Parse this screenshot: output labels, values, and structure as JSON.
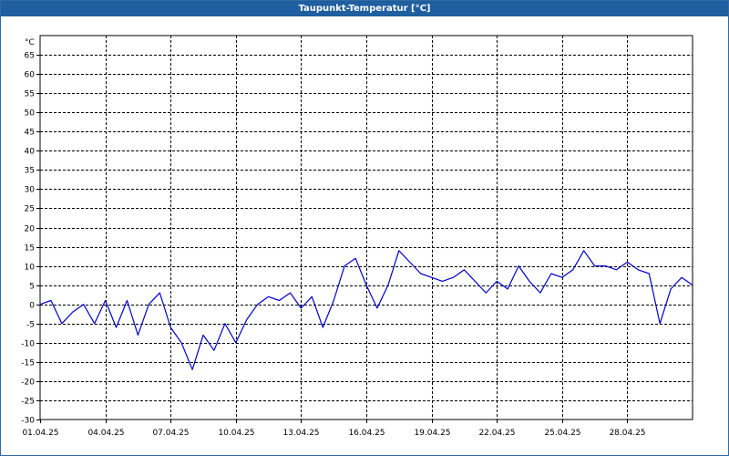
{
  "window": {
    "title": "Taupunkt-Temperatur [°C]"
  },
  "colors": {
    "titlebar": "#1f5f9f",
    "series": "#0000cc",
    "grid": "#000000",
    "background": "#ffffff"
  },
  "chart_data": {
    "type": "line",
    "title": "Taupunkt-Temperatur [°C]",
    "ylabel": "°C",
    "xlabel": "",
    "ylim": [
      -30,
      70
    ],
    "y_ticks": [
      65,
      60,
      55,
      50,
      45,
      40,
      35,
      30,
      25,
      20,
      15,
      10,
      5,
      0,
      -5,
      -10,
      -15,
      -20,
      -25,
      -30
    ],
    "xlim": [
      "01.04.25",
      "01.05.25"
    ],
    "x_ticks": [
      "01.04.25",
      "04.04.25",
      "07.04.25",
      "10.04.25",
      "13.04.25",
      "16.04.25",
      "19.04.25",
      "22.04.25",
      "25.04.25",
      "28.04.25"
    ],
    "grid": true,
    "legend": "none",
    "series": [
      {
        "points": [
          [
            "01.04.25",
            0
          ],
          [
            "01.04.25 12:00",
            1
          ],
          [
            "02.04.25",
            -5
          ],
          [
            "02.04.25 12:00",
            -2
          ],
          [
            "03.04.25",
            0
          ],
          [
            "03.04.25 12:00",
            -5
          ],
          [
            "04.04.25",
            1
          ],
          [
            "04.04.25 12:00",
            -6
          ],
          [
            "05.04.25",
            1
          ],
          [
            "05.04.25 12:00",
            -8
          ],
          [
            "06.04.25",
            0
          ],
          [
            "06.04.25 12:00",
            3
          ],
          [
            "07.04.25",
            -6
          ],
          [
            "07.04.25 12:00",
            -10
          ],
          [
            "08.04.25",
            -17
          ],
          [
            "08.04.25 12:00",
            -8
          ],
          [
            "09.04.25",
            -12
          ],
          [
            "09.04.25 12:00",
            -5
          ],
          [
            "10.04.25",
            -10
          ],
          [
            "10.04.25 12:00",
            -4
          ],
          [
            "11.04.25",
            0
          ],
          [
            "11.04.25 12:00",
            2
          ],
          [
            "12.04.25",
            1
          ],
          [
            "12.04.25 12:00",
            3
          ],
          [
            "13.04.25",
            -1
          ],
          [
            "13.04.25 12:00",
            2
          ],
          [
            "14.04.25",
            -6
          ],
          [
            "14.04.25 12:00",
            1
          ],
          [
            "15.04.25",
            10
          ],
          [
            "15.04.25 12:00",
            12
          ],
          [
            "16.04.25",
            5
          ],
          [
            "16.04.25 12:00",
            -1
          ],
          [
            "17.04.25",
            5
          ],
          [
            "17.04.25 12:00",
            14
          ],
          [
            "18.04.25",
            11
          ],
          [
            "18.04.25 12:00",
            8
          ],
          [
            "19.04.25",
            7
          ],
          [
            "19.04.25 12:00",
            6
          ],
          [
            "20.04.25",
            7
          ],
          [
            "20.04.25 12:00",
            9
          ],
          [
            "21.04.25",
            6
          ],
          [
            "21.04.25 12:00",
            3
          ],
          [
            "22.04.25",
            6
          ],
          [
            "22.04.25 12:00",
            4
          ],
          [
            "23.04.25",
            10
          ],
          [
            "23.04.25 12:00",
            6
          ],
          [
            "24.04.25",
            3
          ],
          [
            "24.04.25 12:00",
            8
          ],
          [
            "25.04.25",
            7
          ],
          [
            "25.04.25 12:00",
            9
          ],
          [
            "26.04.25",
            14
          ],
          [
            "26.04.25 12:00",
            10
          ],
          [
            "27.04.25",
            10
          ],
          [
            "27.04.25 12:00",
            9
          ],
          [
            "28.04.25",
            11
          ],
          [
            "28.04.25 12:00",
            9
          ],
          [
            "29.04.25",
            8
          ],
          [
            "29.04.25 12:00",
            -5
          ],
          [
            "30.04.25",
            4
          ],
          [
            "30.04.25 12:00",
            7
          ],
          [
            "01.05.25",
            5
          ]
        ]
      }
    ]
  }
}
